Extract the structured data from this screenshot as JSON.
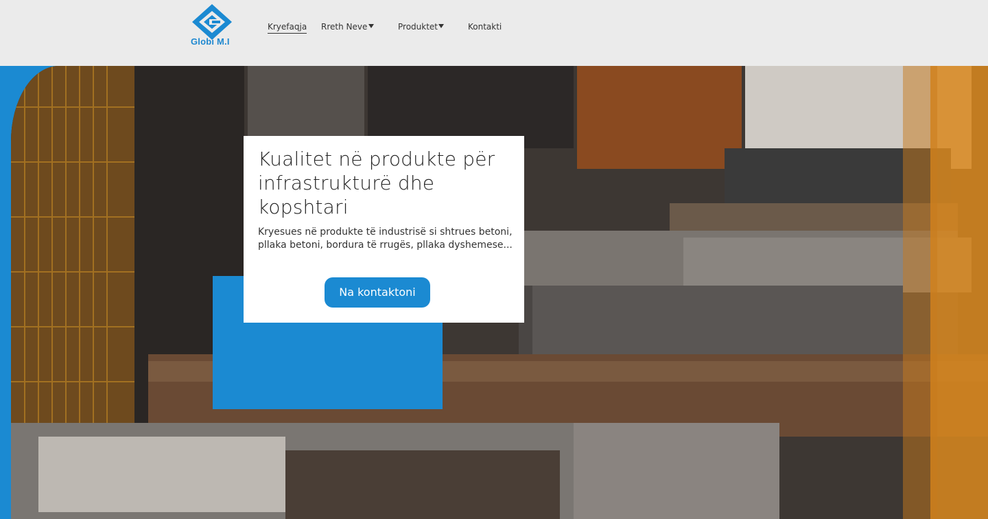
{
  "colors": {
    "accent": "#1b8ad2",
    "header_bg": "#ebebeb",
    "text": "#333333",
    "card_bg": "#ffffff"
  },
  "logo": {
    "icon": "logo-diamond-icon",
    "text": "Globi M.I"
  },
  "nav": {
    "items": [
      {
        "label": "Kryefaqja",
        "active": true,
        "dropdown": false
      },
      {
        "label": "Rreth Neve",
        "active": false,
        "dropdown": true
      },
      {
        "label": "Produktet",
        "active": false,
        "dropdown": true
      },
      {
        "label": "Kontakti",
        "active": false,
        "dropdown": false
      }
    ]
  },
  "hero": {
    "title": "Kualitet në produkte për infrastrukturë dhe kopshtari",
    "text": "Kryesues në produkte të industrisë si shtrues betoni, pllaka betoni, bordura të rrugës, pllaka dyshemese...",
    "button_label": "Na kontaktoni"
  }
}
